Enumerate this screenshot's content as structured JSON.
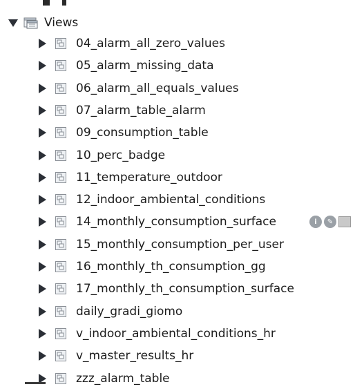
{
  "tree": {
    "root_label": "Views",
    "root_expanded": true,
    "root_icon": "views-folder-icon",
    "child_icon": "view-icon",
    "children": [
      {
        "label": "04_alarm_all_zero_values"
      },
      {
        "label": "05_alarm_missing_data"
      },
      {
        "label": "06_alarm_all_equals_values"
      },
      {
        "label": "07_alarm_table_alarm"
      },
      {
        "label": "09_consumption_table"
      },
      {
        "label": "10_perc_badge"
      },
      {
        "label": "11_temperature_outdoor"
      },
      {
        "label": "12_indoor_ambiental_conditions"
      },
      {
        "label": "14_monthly_consumption_surface"
      },
      {
        "label": "15_monthly_consumption_per_user"
      },
      {
        "label": "16_monthly_th_consumption_gg"
      },
      {
        "label": "17_monthly_th_consumption_surface"
      },
      {
        "label": "daily_gradi_giomo"
      },
      {
        "label": "v_indoor_ambiental_conditions_hr"
      },
      {
        "label": "v_master_results_hr"
      },
      {
        "label": "zzz_alarm_table"
      }
    ]
  },
  "colors": {
    "text": "#1c1c1c",
    "arrow": "#2b2f36",
    "icon_border": "#8a8f96",
    "icon_fill": "#e8ecf0"
  }
}
